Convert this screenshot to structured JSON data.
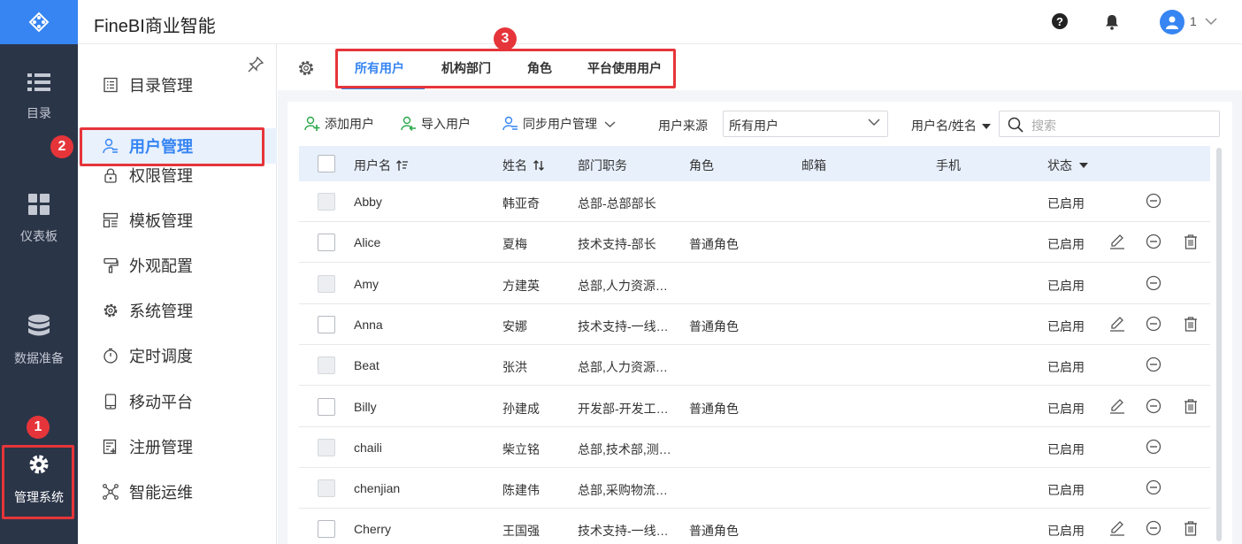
{
  "header": {
    "brand": "FineBI商业智能",
    "user_name": "1"
  },
  "rail": {
    "items": [
      {
        "label": "目录",
        "icon": "list-icon"
      },
      {
        "label": "仪表板",
        "icon": "dashboard-icon"
      },
      {
        "label": "数据准备",
        "icon": "database-icon"
      },
      {
        "label": "管理系统",
        "icon": "gear-icon"
      }
    ]
  },
  "submenu": {
    "items": [
      {
        "label": "目录管理",
        "icon": "catalog-icon"
      },
      {
        "label": "用户管理",
        "icon": "user-icon",
        "active": true
      },
      {
        "label": "权限管理",
        "icon": "lock-icon"
      },
      {
        "label": "模板管理",
        "icon": "template-icon"
      },
      {
        "label": "外观配置",
        "icon": "brush-icon"
      },
      {
        "label": "系统管理",
        "icon": "gear-icon"
      },
      {
        "label": "定时调度",
        "icon": "timer-icon"
      },
      {
        "label": "移动平台",
        "icon": "mobile-icon"
      },
      {
        "label": "注册管理",
        "icon": "register-icon"
      },
      {
        "label": "智能运维",
        "icon": "network-icon"
      }
    ]
  },
  "tabs": [
    "所有用户",
    "机构部门",
    "角色",
    "平台使用用户"
  ],
  "toolbar": {
    "add_user": "添加用户",
    "import_user": "导入用户",
    "sync_user": "同步用户管理",
    "source_label": "用户来源",
    "source_value": "所有用户",
    "filter_label": "用户名/姓名",
    "search_placeholder": "搜索"
  },
  "table": {
    "columns": [
      "用户名",
      "姓名",
      "部门职务",
      "角色",
      "邮箱",
      "手机",
      "状态"
    ],
    "rows": [
      {
        "username": "Abby",
        "name": "韩亚奇",
        "dept": "总部-总部部长",
        "role": "",
        "email": "",
        "phone": "",
        "status": "已启用",
        "editable": false
      },
      {
        "username": "Alice",
        "name": "夏梅",
        "dept": "技术支持-部长",
        "role": "普通角色",
        "email": "",
        "phone": "",
        "status": "已启用",
        "editable": true
      },
      {
        "username": "Amy",
        "name": "方建英",
        "dept": "总部,人力资源…",
        "role": "",
        "email": "",
        "phone": "",
        "status": "已启用",
        "editable": false
      },
      {
        "username": "Anna",
        "name": "安娜",
        "dept": "技术支持-一线…",
        "role": "普通角色",
        "email": "",
        "phone": "",
        "status": "已启用",
        "editable": true
      },
      {
        "username": "Beat",
        "name": "张洪",
        "dept": "总部,人力资源…",
        "role": "",
        "email": "",
        "phone": "",
        "status": "已启用",
        "editable": false
      },
      {
        "username": "Billy",
        "name": "孙建成",
        "dept": "开发部-开发工…",
        "role": "普通角色",
        "email": "",
        "phone": "",
        "status": "已启用",
        "editable": true
      },
      {
        "username": "chaili",
        "name": "柴立铭",
        "dept": "总部,技术部,测…",
        "role": "",
        "email": "",
        "phone": "",
        "status": "已启用",
        "editable": false
      },
      {
        "username": "chenjian",
        "name": "陈建伟",
        "dept": "总部,采购物流…",
        "role": "",
        "email": "",
        "phone": "",
        "status": "已启用",
        "editable": false
      },
      {
        "username": "Cherry",
        "name": "王国强",
        "dept": "技术支持-一线…",
        "role": "普通角色",
        "email": "",
        "phone": "",
        "status": "已启用",
        "editable": true
      }
    ]
  },
  "annotations": [
    "1",
    "2",
    "3"
  ],
  "colors": {
    "accent": "#3685f2",
    "rail": "#2b3548",
    "callout": "#e6353a"
  }
}
